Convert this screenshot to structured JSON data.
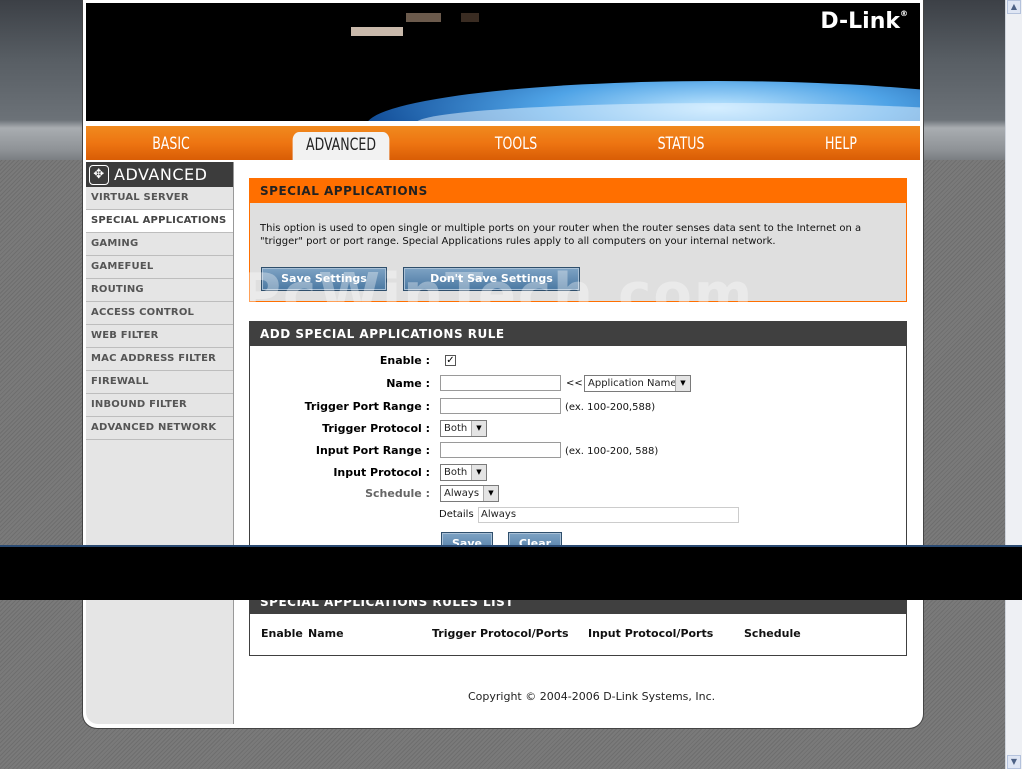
{
  "banner": {
    "logo": "D-Link"
  },
  "nav": {
    "tabs": [
      "BASIC",
      "ADVANCED",
      "TOOLS",
      "STATUS",
      "HELP"
    ],
    "active": "ADVANCED"
  },
  "sidebar": {
    "title": "ADVANCED",
    "items": [
      "VIRTUAL SERVER",
      "SPECIAL APPLICATIONS",
      "GAMING",
      "GAMEFUEL",
      "ROUTING",
      "ACCESS CONTROL",
      "WEB FILTER",
      "MAC ADDRESS FILTER",
      "FIREWALL",
      "INBOUND FILTER",
      "ADVANCED NETWORK"
    ],
    "active_index": 1
  },
  "special_apps": {
    "title": "SPECIAL APPLICATIONS",
    "description": "This option is used to open single or multiple ports on your router when the router senses data sent to the Internet on a \"trigger\" port or port range. Special Applications rules apply to all computers on your internal network.",
    "save_label": "Save Settings",
    "dont_save_label": "Don't Save Settings"
  },
  "add_rule": {
    "title": "ADD SPECIAL APPLICATIONS RULE",
    "enable_label": "Enable :",
    "enable_checked": "✓",
    "name_label": "Name :",
    "name_value": "",
    "arrows": "<<",
    "app_select": "Application Name",
    "trigger_range_label": "Trigger Port Range :",
    "trigger_range_value": "",
    "trigger_range_hint": "(ex. 100-200,588)",
    "trigger_proto_label": "Trigger Protocol :",
    "trigger_proto_value": "Both",
    "input_range_label": "Input Port Range :",
    "input_range_value": "",
    "input_range_hint": "(ex. 100-200, 588)",
    "input_proto_label": "Input Protocol :",
    "input_proto_value": "Both",
    "schedule_label": "Schedule :",
    "schedule_value": "Always",
    "details_label": "Details :",
    "details_value": "Always",
    "save_label": "Save",
    "clear_label": "Clear"
  },
  "rules_list": {
    "title": "SPECIAL APPLICATIONS RULES LIST",
    "columns": [
      "Enable",
      "Name",
      "Trigger Protocol/Ports",
      "Input Protocol/Ports",
      "Schedule"
    ]
  },
  "watermark": "PcWinTech.com",
  "copyright": "Copyright © 2004-2006 D-Link Systems, Inc."
}
